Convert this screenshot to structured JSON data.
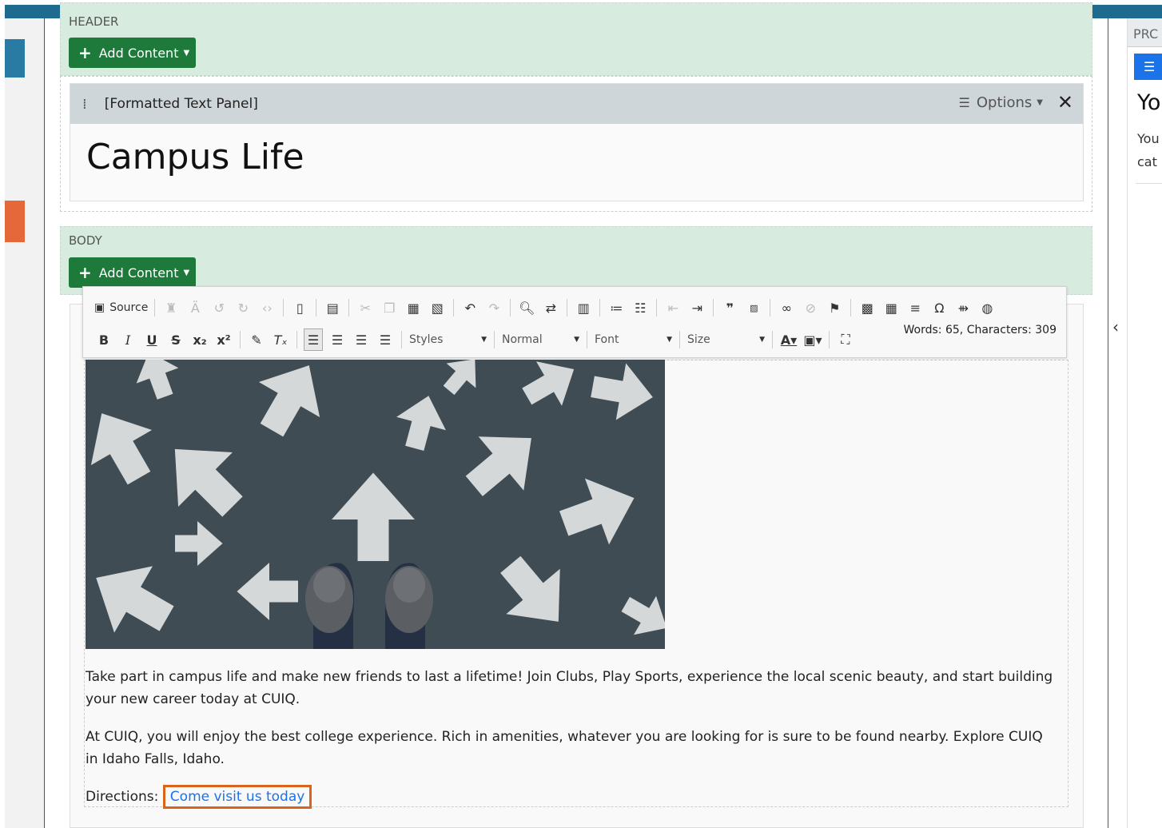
{
  "header_section": {
    "title": "HEADER",
    "add_label": "Add Content"
  },
  "panel": {
    "title": "[Formatted Text Panel]",
    "options_label": "Options",
    "heading": "Campus Life"
  },
  "body_section": {
    "title": "BODY",
    "add_label": "Add Content"
  },
  "toolbar": {
    "source_label": "Source",
    "styles_label": "Styles",
    "format_label": "Normal",
    "font_label": "Font",
    "size_label": "Size",
    "word_count": "Words: 65, Characters: 309"
  },
  "content": {
    "paragraph1": "Take part in campus life and make new friends to last a lifetime!  Join Clubs, Play Sports, experience the local scenic beauty, and start building your new career today at CUIQ.",
    "paragraph2": "At CUIQ, you will enjoy the best college experience. Rich in amenities, whatever you are looking for is sure to be found nearby.  Explore CUIQ in Idaho Falls, Idaho.",
    "directions_label": "Directions:",
    "link_text": "Come visit us today"
  },
  "right_panel": {
    "tab_label": "PRC",
    "heading": "Yo",
    "line1": "You",
    "line2": "cat"
  },
  "colors": {
    "topbar": "#1e6b8f",
    "section_bg": "#d7ebdf",
    "add_button": "#1d7a3b",
    "link": "#1a73e8",
    "highlight_border": "#d9641e"
  }
}
